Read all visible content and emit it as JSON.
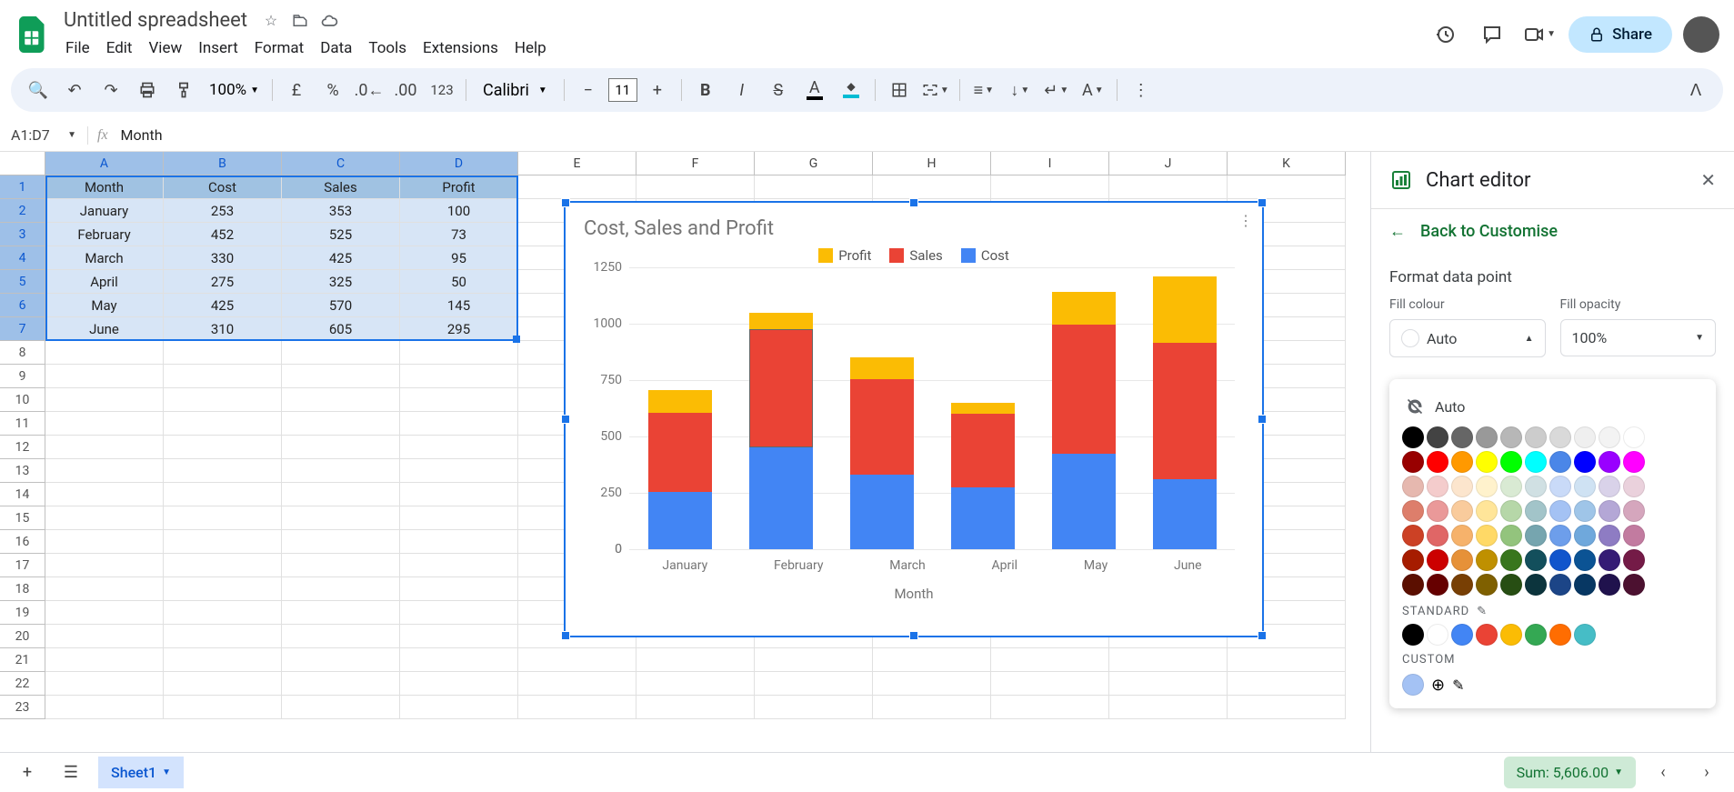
{
  "doc": {
    "title": "Untitled spreadsheet"
  },
  "menus": [
    "File",
    "Edit",
    "View",
    "Insert",
    "Format",
    "Data",
    "Tools",
    "Extensions",
    "Help"
  ],
  "share_label": "Share",
  "toolbar": {
    "zoom": "100%",
    "font_name": "Calibri",
    "font_size": "11"
  },
  "namebox": "A1:D7",
  "formula": "Month",
  "columns": [
    "A",
    "B",
    "C",
    "D",
    "E",
    "F",
    "G",
    "H",
    "I",
    "J",
    "K"
  ],
  "rows": 23,
  "data": {
    "headers": [
      "Month",
      "Cost",
      "Sales",
      "Profit"
    ],
    "rows": [
      [
        "January",
        "253",
        "353",
        "100"
      ],
      [
        "February",
        "452",
        "525",
        "73"
      ],
      [
        "March",
        "330",
        "425",
        "95"
      ],
      [
        "April",
        "275",
        "325",
        "50"
      ],
      [
        "May",
        "425",
        "570",
        "145"
      ],
      [
        "June",
        "310",
        "605",
        "295"
      ]
    ]
  },
  "chart_data": {
    "type": "bar",
    "stacked": true,
    "title": "Cost, Sales and Profit",
    "xlabel": "Month",
    "ylabel": "",
    "ylim": [
      0,
      1250
    ],
    "yticks": [
      0,
      250,
      500,
      750,
      1000,
      1250
    ],
    "categories": [
      "January",
      "February",
      "March",
      "April",
      "May",
      "June"
    ],
    "series": [
      {
        "name": "Cost",
        "color": "#4285f4",
        "values": [
          253,
          452,
          330,
          275,
          425,
          310
        ]
      },
      {
        "name": "Sales",
        "color": "#ea4335",
        "values": [
          353,
          525,
          425,
          325,
          570,
          605
        ]
      },
      {
        "name": "Profit",
        "color": "#fbbc04",
        "values": [
          100,
          73,
          95,
          50,
          145,
          295
        ]
      }
    ],
    "legend_order": [
      "Profit",
      "Sales",
      "Cost"
    ],
    "selected_bar": {
      "category": "February",
      "series": "Sales"
    }
  },
  "sidebar": {
    "title": "Chart editor",
    "back_label": "Back to Customise",
    "section": "Format data point",
    "fill_colour_label": "Fill colour",
    "fill_opacity_label": "Fill opacity",
    "fill_colour_value": "Auto",
    "fill_opacity_value": "100%",
    "popup": {
      "auto": "Auto",
      "standard": "STANDARD",
      "custom": "CUSTOM",
      "greys": [
        "#000000",
        "#434343",
        "#666666",
        "#999999",
        "#b7b7b7",
        "#cccccc",
        "#d9d9d9",
        "#efefef",
        "#f3f3f3",
        "#ffffff"
      ],
      "primaries": [
        "#980000",
        "#ff0000",
        "#ff9900",
        "#ffff00",
        "#00ff00",
        "#00ffff",
        "#4a86e8",
        "#0000ff",
        "#9900ff",
        "#ff00ff"
      ],
      "tint1": [
        "#e6b8af",
        "#f4cccc",
        "#fce5cd",
        "#fff2cc",
        "#d9ead3",
        "#d0e0e3",
        "#c9daf8",
        "#cfe2f3",
        "#d9d2e9",
        "#ead1dc"
      ],
      "tint2": [
        "#dd7e6b",
        "#ea9999",
        "#f9cb9c",
        "#ffe599",
        "#b6d7a8",
        "#a2c4c9",
        "#a4c2f4",
        "#9fc5e8",
        "#b4a7d6",
        "#d5a6bd"
      ],
      "tint3": [
        "#cc4125",
        "#e06666",
        "#f6b26b",
        "#ffd966",
        "#93c47d",
        "#76a5af",
        "#6d9eeb",
        "#6fa8dc",
        "#8e7cc3",
        "#c27ba0"
      ],
      "tint4": [
        "#a61c00",
        "#cc0000",
        "#e69138",
        "#bf9000",
        "#38761d",
        "#134f5c",
        "#1155cc",
        "#0b5394",
        "#351c75",
        "#741b47"
      ],
      "tint5": [
        "#5b0f00",
        "#660000",
        "#783f04",
        "#7f6000",
        "#274e13",
        "#0c343d",
        "#1c4587",
        "#073763",
        "#20124d",
        "#4c1130"
      ],
      "standard_colors": [
        "#000000",
        "#ffffff",
        "#4285f4",
        "#ea4335",
        "#fbbc04",
        "#34a853",
        "#ff6d01",
        "#46bdc6"
      ],
      "custom_colors": [
        "#a4c2f4"
      ]
    }
  },
  "bottom": {
    "sheet": "Sheet1",
    "sum": "Sum: 5,606.00"
  }
}
